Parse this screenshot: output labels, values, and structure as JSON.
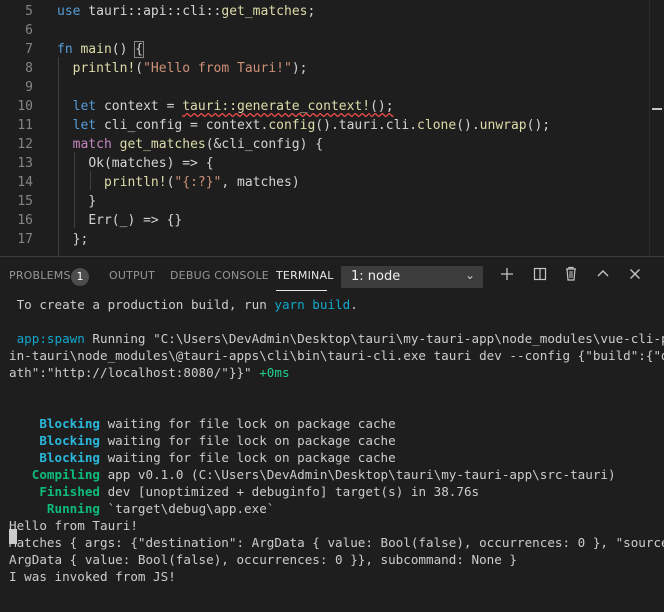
{
  "editor": {
    "lines": [
      {
        "num": "5",
        "indent": "",
        "parts": [
          {
            "t": "use",
            "c": "kw"
          },
          {
            "t": " tauri::api::cli::",
            "c": ""
          },
          {
            "t": "get_matches",
            "c": "fn"
          },
          {
            "t": ";",
            "c": ""
          }
        ]
      },
      {
        "num": "6",
        "indent": "",
        "parts": []
      },
      {
        "num": "7",
        "indent": "",
        "parts": [
          {
            "t": "fn",
            "c": "kw"
          },
          {
            "t": " ",
            "c": ""
          },
          {
            "t": "main",
            "c": "fn"
          },
          {
            "t": "() ",
            "c": ""
          },
          {
            "t": "{",
            "c": "bm"
          }
        ]
      },
      {
        "num": "8",
        "indent": "  ",
        "parts": [
          {
            "t": "println!",
            "c": "fn"
          },
          {
            "t": "(",
            "c": ""
          },
          {
            "t": "\"Hello from Tauri!\"",
            "c": "str"
          },
          {
            "t": ");",
            "c": ""
          }
        ]
      },
      {
        "num": "9",
        "indent": "",
        "parts": []
      },
      {
        "num": "10",
        "indent": "  ",
        "parts": [
          {
            "t": "let",
            "c": "kw"
          },
          {
            "t": " context = ",
            "c": ""
          },
          {
            "t": "tauri::generate_context!",
            "c": "fn squig"
          },
          {
            "t": "();",
            "c": "squig"
          }
        ]
      },
      {
        "num": "11",
        "indent": "  ",
        "parts": [
          {
            "t": "let",
            "c": "kw"
          },
          {
            "t": " cli_config = context.",
            "c": ""
          },
          {
            "t": "config",
            "c": "fn"
          },
          {
            "t": "().tauri.cli.",
            "c": ""
          },
          {
            "t": "clone",
            "c": "fn"
          },
          {
            "t": "().",
            "c": ""
          },
          {
            "t": "unwrap",
            "c": "fn"
          },
          {
            "t": "();",
            "c": ""
          }
        ]
      },
      {
        "num": "12",
        "indent": "  ",
        "parts": [
          {
            "t": "match",
            "c": "ctl"
          },
          {
            "t": " ",
            "c": ""
          },
          {
            "t": "get_matches",
            "c": "fn"
          },
          {
            "t": "(&cli_config) {",
            "c": ""
          }
        ]
      },
      {
        "num": "13",
        "indent": "    ",
        "parts": [
          {
            "t": "Ok(matches) => {",
            "c": ""
          }
        ]
      },
      {
        "num": "14",
        "indent": "      ",
        "parts": [
          {
            "t": "println!",
            "c": "fn"
          },
          {
            "t": "(",
            "c": ""
          },
          {
            "t": "\"{:?}\"",
            "c": "str"
          },
          {
            "t": ", matches)",
            "c": ""
          }
        ]
      },
      {
        "num": "15",
        "indent": "    ",
        "parts": [
          {
            "t": "}",
            "c": ""
          }
        ]
      },
      {
        "num": "16",
        "indent": "    ",
        "parts": [
          {
            "t": "Err(_) => {}",
            "c": ""
          }
        ]
      },
      {
        "num": "17",
        "indent": "  ",
        "parts": [
          {
            "t": "};",
            "c": ""
          }
        ]
      }
    ]
  },
  "panel": {
    "tabs": {
      "problems": "PROBLEMS",
      "problems_count": "1",
      "output": "OUTPUT",
      "debug_console": "DEBUG CONSOLE",
      "terminal": "TERMINAL"
    },
    "terminal_select": "1: node",
    "icons": {
      "add": "plus-icon",
      "split": "split-terminal-icon",
      "kill": "trash-icon",
      "maximize": "chevron-up-icon",
      "close": "close-icon"
    }
  },
  "terminal": {
    "lines": [
      [
        {
          "t": " To create a production build, run ",
          "c": ""
        },
        {
          "t": "yarn build",
          "c": "cy"
        },
        {
          "t": ".",
          "c": ""
        }
      ],
      [],
      [
        {
          "t": " app:spawn",
          "c": "cy"
        },
        {
          "t": " Running \"C:\\Users\\DevAdmin\\Desktop\\tauri\\my-tauri-app\\node_modules\\vue-cli-plug",
          "c": ""
        }
      ],
      [
        {
          "t": "in-tauri\\node_modules\\@tauri-apps\\cli\\bin\\tauri-cli.exe tauri dev --config {\"build\":{\"devP",
          "c": ""
        }
      ],
      [
        {
          "t": "ath\":\"http://localhost:8080/\"}}\" ",
          "c": ""
        },
        {
          "t": "+0ms",
          "c": "gr"
        }
      ],
      [],
      [],
      [
        {
          "t": "    Blocking",
          "c": "c"
        },
        {
          "t": " waiting for file lock on package cache",
          "c": ""
        }
      ],
      [
        {
          "t": "    Blocking",
          "c": "c"
        },
        {
          "t": " waiting for file lock on package cache",
          "c": ""
        }
      ],
      [
        {
          "t": "    Blocking",
          "c": "c"
        },
        {
          "t": " waiting for file lock on package cache",
          "c": ""
        }
      ],
      [
        {
          "t": "   Compiling",
          "c": "g"
        },
        {
          "t": " app v0.1.0 (C:\\Users\\DevAdmin\\Desktop\\tauri\\my-tauri-app\\src-tauri)",
          "c": ""
        }
      ],
      [
        {
          "t": "    Finished",
          "c": "g"
        },
        {
          "t": " dev [unoptimized + debuginfo] target(s) in 38.76s",
          "c": ""
        }
      ],
      [
        {
          "t": "     Running",
          "c": "g"
        },
        {
          "t": " `target\\debug\\app.exe`",
          "c": ""
        }
      ],
      [
        {
          "t": "Hello from Tauri!",
          "c": ""
        }
      ],
      [
        {
          "t": "Matches { args: {\"destination\": ArgData { value: Bool(false), occurrences: 0 }, \"source\":",
          "c": ""
        }
      ],
      [
        {
          "t": "ArgData { value: Bool(false), occurrences: 0 }}, subcommand: None }",
          "c": ""
        }
      ],
      [
        {
          "t": "I was invoked from JS!",
          "c": ""
        }
      ]
    ]
  }
}
